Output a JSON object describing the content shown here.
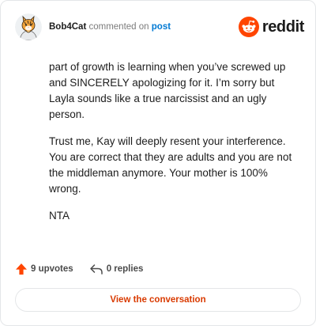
{
  "header": {
    "username": "Bob4Cat",
    "action_text": "commented on",
    "post_link": "post",
    "brand_name": "reddit"
  },
  "comment": {
    "paragraphs": [
      "part of growth is learning when you’ve screwed up and SINCERELY apologizing for it. I’m sorry but Layla sounds like a true narcissist and an ugly person.",
      "Trust me, Kay will deeply resent your interference. You are correct that they are adults and you are not the middleman anymore. Your mother is 100% wrong.",
      "NTA"
    ]
  },
  "footer": {
    "upvotes": "9 upvotes",
    "replies": "0 replies"
  },
  "cta": {
    "label": "View the conversation"
  },
  "colors": {
    "brand_orange": "#ff4500",
    "link_blue": "#0079d3",
    "cta_text": "#d93a00"
  },
  "icons": {
    "avatar": "tabby-cat-avatar",
    "brand": "reddit-snoo-icon",
    "upvote": "upvote-arrow-icon",
    "reply": "reply-arrow-icon"
  }
}
